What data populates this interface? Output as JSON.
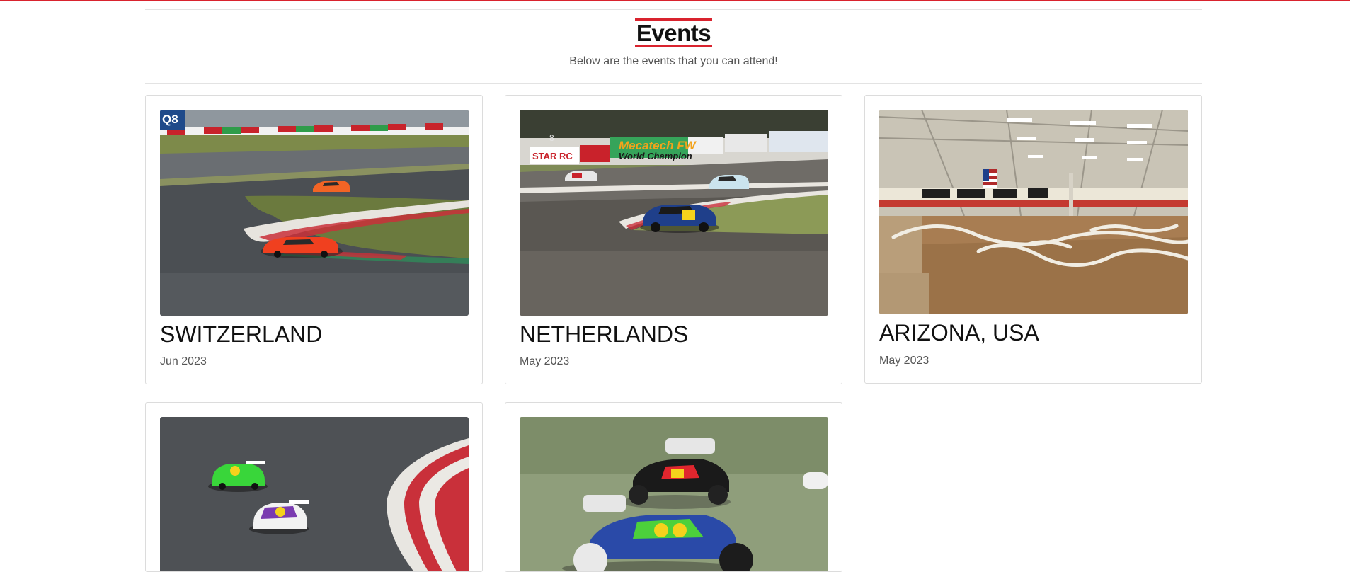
{
  "header": {
    "title": "Events",
    "subtitle": "Below are the events that you can attend!"
  },
  "events": [
    {
      "name": "SWITZERLAND",
      "date": "Jun 2023",
      "image": "road-track-photo"
    },
    {
      "name": "NETHERLANDS",
      "date": "May 2023",
      "image": "road-track-photo"
    },
    {
      "name": "ARIZONA, USA",
      "date": "May 2023",
      "image": "indoor-dirt-track-photo"
    },
    {
      "name": "",
      "date": "",
      "image": "road-track-photo"
    },
    {
      "name": "",
      "date": "",
      "image": "buggy-race-photo"
    }
  ],
  "image_texts": {
    "card0_banner": "Q8",
    "card1_banner_1": "STAR RC",
    "card1_banner_2": "Mecatech FW",
    "card1_banner_3": "World Champion",
    "card1_number": "8"
  },
  "colors": {
    "accent": "#d9232e",
    "text": "#111111",
    "muted": "#555555",
    "border": "#dcdcdc"
  }
}
